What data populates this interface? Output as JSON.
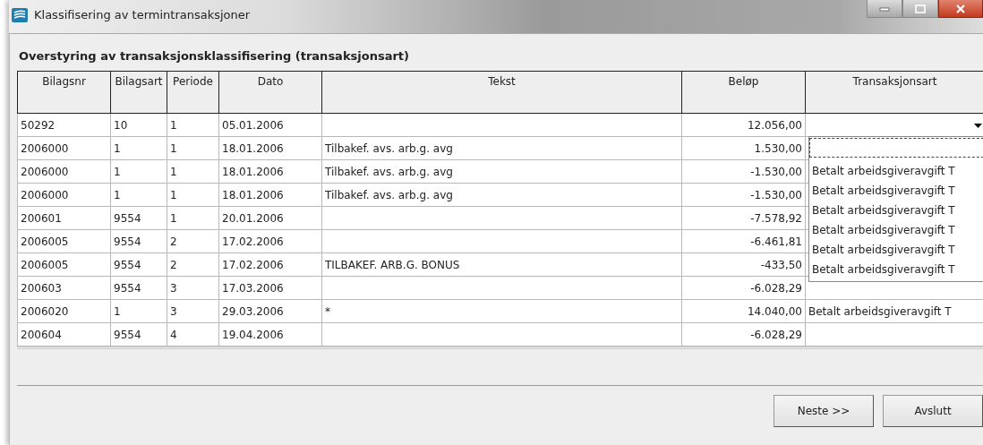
{
  "window": {
    "title": "Klassifisering av termintransaksjoner"
  },
  "heading": "Overstyring av transaksjonsklassifisering (transaksjonsart)",
  "table": {
    "columns": [
      {
        "label": "Bilagsnr",
        "kind": "text"
      },
      {
        "label": "Bilagsart",
        "kind": "text"
      },
      {
        "label": "Periode",
        "kind": "text"
      },
      {
        "label": "Dato",
        "kind": "text"
      },
      {
        "label": "Tekst",
        "kind": "text"
      },
      {
        "label": "Beløp",
        "kind": "amount"
      },
      {
        "label": "Transaksjonsart",
        "kind": "text"
      }
    ],
    "rows": [
      {
        "cells": [
          "50292",
          "10",
          "1",
          "05.01.2006",
          "",
          "12.056,00",
          ""
        ],
        "editing": true
      },
      {
        "cells": [
          "2006000",
          "1",
          "1",
          "18.01.2006",
          "Tilbakef. avs. arb.g. avg",
          "1.530,00",
          ""
        ],
        "editing": false
      },
      {
        "cells": [
          "2006000",
          "1",
          "1",
          "18.01.2006",
          "Tilbakef. avs. arb.g. avg",
          "-1.530,00",
          ""
        ],
        "editing": false
      },
      {
        "cells": [
          "2006000",
          "1",
          "1",
          "18.01.2006",
          "Tilbakef. avs. arb.g. avg",
          "-1.530,00",
          ""
        ],
        "editing": false
      },
      {
        "cells": [
          "200601",
          "9554",
          "1",
          "20.01.2006",
          "",
          "-7.578,92",
          ""
        ],
        "editing": false
      },
      {
        "cells": [
          "2006005",
          "9554",
          "2",
          "17.02.2006",
          "",
          "-6.461,81",
          ""
        ],
        "editing": false
      },
      {
        "cells": [
          "2006005",
          "9554",
          "2",
          "17.02.2006",
          "TILBAKEF. ARB.G. BONUS",
          "-433,50",
          ""
        ],
        "editing": false
      },
      {
        "cells": [
          "200603",
          "9554",
          "3",
          "17.03.2006",
          "",
          "-6.028,29",
          ""
        ],
        "editing": false
      },
      {
        "cells": [
          "2006020",
          "1",
          "3",
          "29.03.2006",
          "*",
          "14.040,00",
          "Betalt arbeidsgiveravgift T"
        ],
        "editing": false
      },
      {
        "cells": [
          "200604",
          "9554",
          "4",
          "19.04.2006",
          "",
          "-6.028,29",
          ""
        ],
        "editing": false
      }
    ]
  },
  "dropdown": {
    "expanded": true,
    "items": [
      {
        "label": "Betalt arbeidsgiveravgift T"
      },
      {
        "label": "Betalt arbeidsgiveravgift T"
      },
      {
        "label": "Betalt arbeidsgiveravgift T"
      },
      {
        "label": "Betalt arbeidsgiveravgift T"
      },
      {
        "label": "Betalt arbeidsgiveravgift T"
      },
      {
        "label": "Betalt arbeidsgiveravgift T"
      }
    ]
  },
  "buttons": [
    {
      "label": "Neste >>"
    },
    {
      "label": "Avslutt"
    }
  ]
}
